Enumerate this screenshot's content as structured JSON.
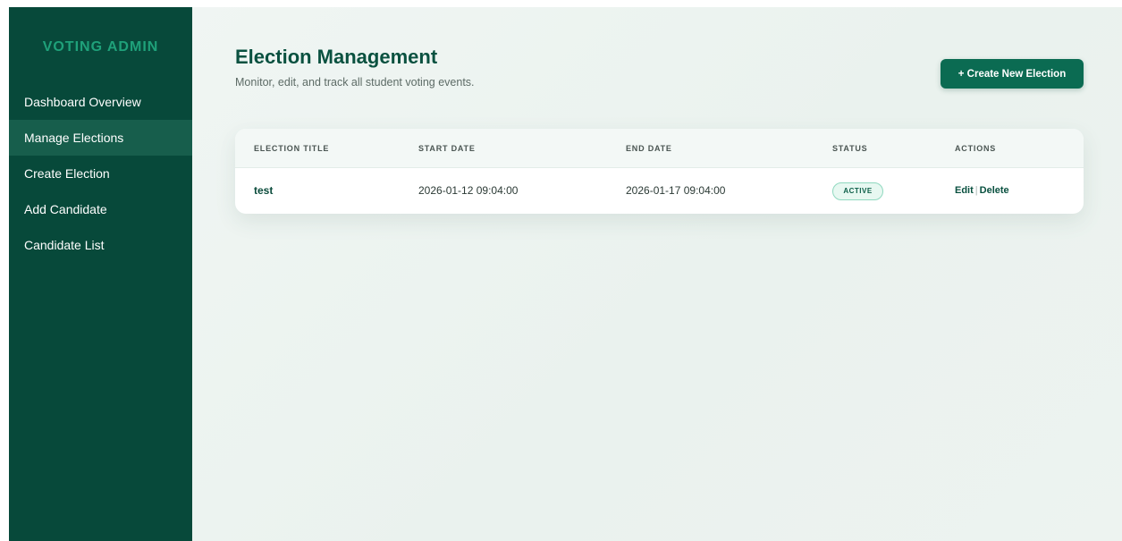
{
  "sidebar": {
    "brand": "VOTING ADMIN",
    "items": [
      {
        "label": "Dashboard Overview"
      },
      {
        "label": "Manage Elections"
      },
      {
        "label": "Create Election"
      },
      {
        "label": "Add Candidate"
      },
      {
        "label": "Candidate List"
      }
    ],
    "active_index": 1
  },
  "header": {
    "title": "Election Management",
    "subtitle": "Monitor, edit, and track all student voting events.",
    "create_button_label": "+ Create New Election"
  },
  "table": {
    "columns": [
      "ELECTION TITLE",
      "START DATE",
      "END DATE",
      "STATUS",
      "ACTIONS"
    ],
    "rows": [
      {
        "title": "test",
        "start_date": "2026-01-12 09:04:00",
        "end_date": "2026-01-17 09:04:00",
        "status": "ACTIVE",
        "edit_label": "Edit",
        "separator": "|",
        "delete_label": "Delete"
      }
    ]
  },
  "colors": {
    "sidebar_bg": "#07493a",
    "sidebar_active": "#175e4c",
    "brand_accent": "#1fa17a",
    "primary_button": "#0b6b52",
    "status_active_bg": "#e7f8f1"
  }
}
